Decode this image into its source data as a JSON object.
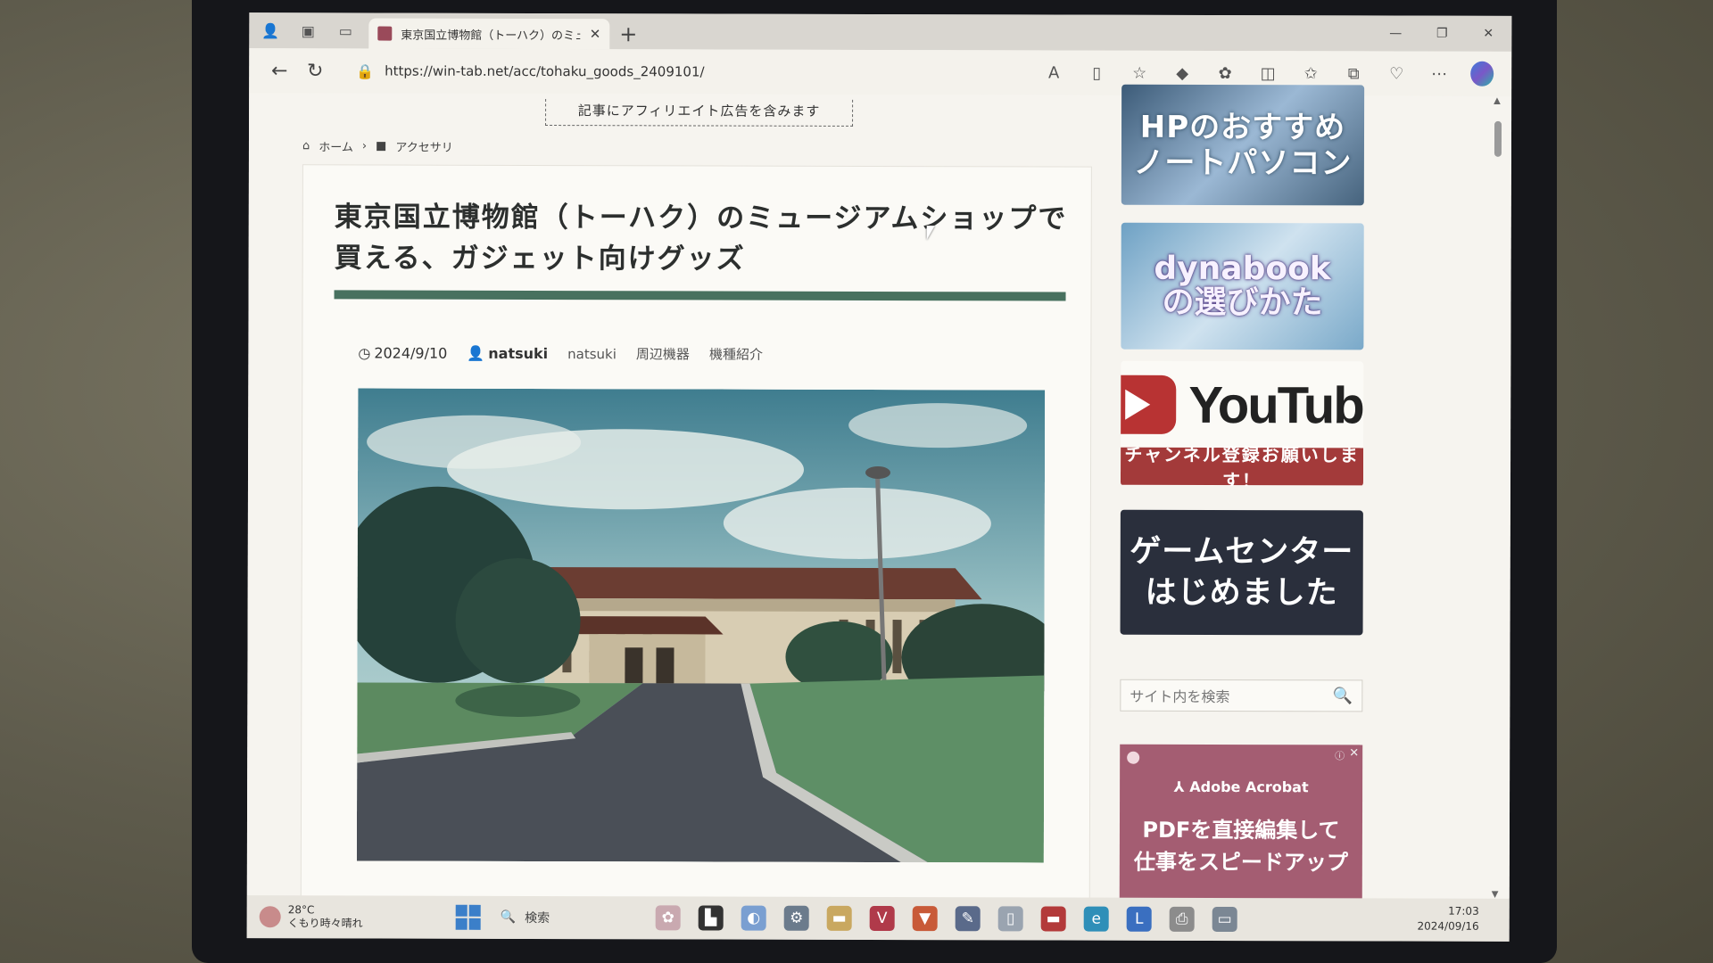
{
  "browser": {
    "tab_title": "東京国立博物館（トーハク）のミュ",
    "tab_close": "✕",
    "new_tab": "+",
    "url": "https://win-tab.net/acc/tohaku_goods_2409101/",
    "window_controls": [
      "—",
      "❐",
      "✕"
    ]
  },
  "page": {
    "ad_notice": "記事にアフィリエイト広告を含みます",
    "breadcrumb": {
      "home": "ホーム",
      "separator": "›",
      "category": "アクセサリ"
    },
    "article": {
      "title": "東京国立博物館（トーハク）のミュージアムショップで買える、ガジェット向けグッズ",
      "date": "2024/9/10",
      "author": "natsuki",
      "tags": [
        "natsuki",
        "周辺機器",
        "機種紹介"
      ]
    },
    "sidebar": {
      "banner1": [
        "HPのおすすめ",
        "ノートパソコン"
      ],
      "banner2": [
        "dynabook",
        "の選びかた"
      ],
      "youtube_word": "YouTube",
      "youtube_cta": "チャンネル登録お願いします！",
      "banner4": [
        "ゲームセンター",
        "はじめました"
      ],
      "search_placeholder": "サイト内を検索",
      "ad": {
        "brand": "Adobe Acrobat",
        "headline": [
          "PDFを直接編集して",
          "仕事をスピードアップ"
        ]
      }
    }
  },
  "taskbar": {
    "temp": "28°C",
    "weather": "くもり時々晴れ",
    "search": "検索",
    "time": "17:03",
    "date": "2024/09/16"
  },
  "colors": {
    "title_bar": "#48715f",
    "youtube_red": "#b83333",
    "ad_bg": "#a45d72",
    "game_banner": "#2a2f3c"
  }
}
